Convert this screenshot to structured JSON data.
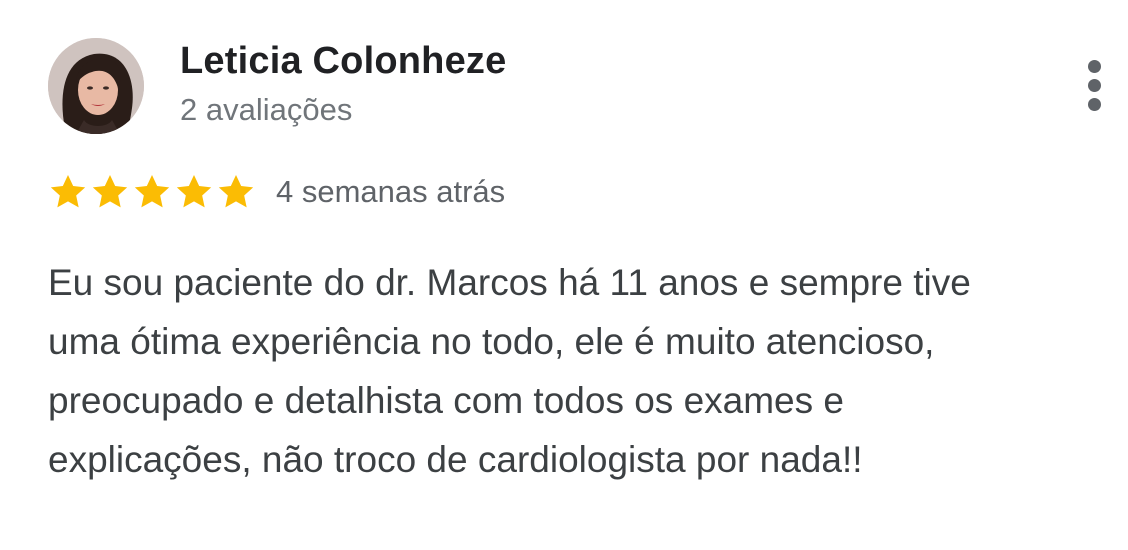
{
  "reviewer": {
    "name": "Leticia Colonheze",
    "review_count": "2 avaliações",
    "avatar_icon": "profile-photo"
  },
  "menu": {
    "icon": "more-vertical-icon"
  },
  "rating": {
    "stars": 5,
    "max_stars": 5,
    "date": "4 semanas atrás",
    "star_color": "#fbbc04"
  },
  "review": {
    "lines": [
      "Eu sou paciente do dr. Marcos há 11 anos e sempre tive",
      "uma ótima experiência no todo, ele é muito atencioso,",
      "preocupado e detalhista com todos os exames e",
      "explicações, não troco de cardiologista por nada!!"
    ]
  },
  "colors": {
    "name": "#202124",
    "secondary": "#70757a",
    "body_text": "#3c4043"
  }
}
